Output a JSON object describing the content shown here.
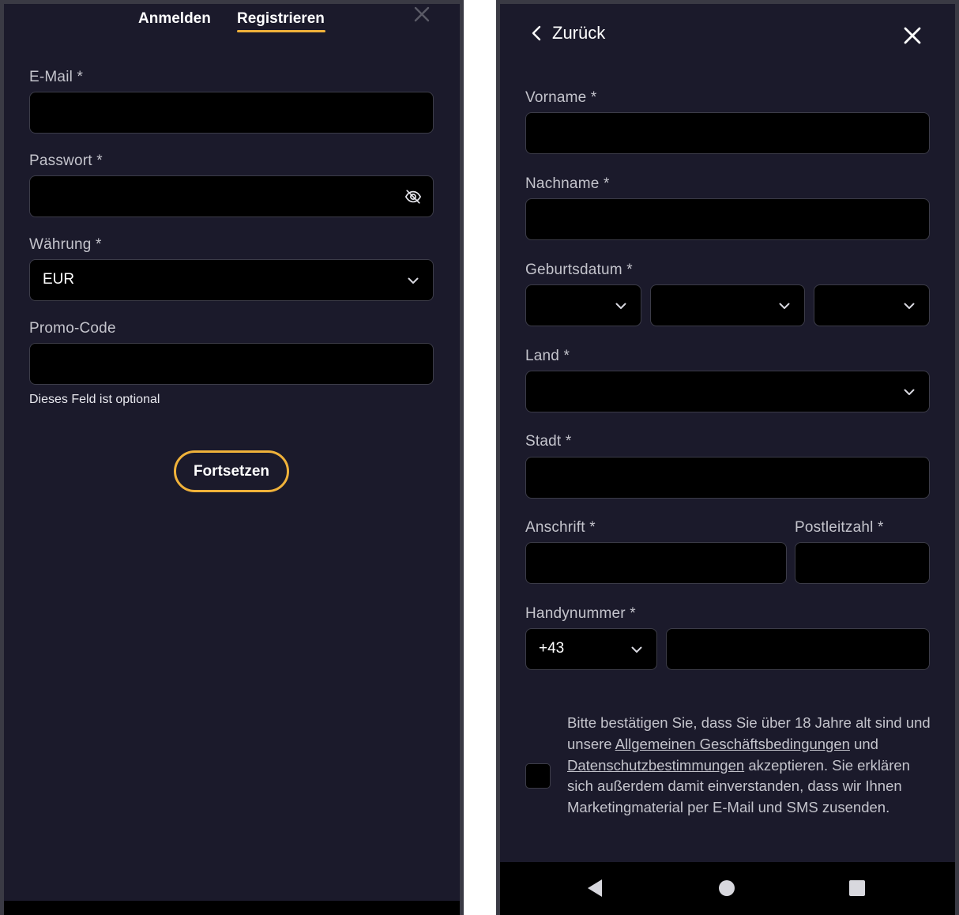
{
  "registration": {
    "tabs": [
      "Anmelden",
      "Registrieren"
    ],
    "active_tab": "Registrieren",
    "email_label": "E-Mail *",
    "password_label": "Passwort *",
    "currency_label": "Währung *",
    "currency_value": "EUR",
    "promo_label": "Promo-Code",
    "promo_hint": "Dieses Feld ist optional",
    "continue_label": "Fortsetzen"
  },
  "personal": {
    "back_label": "Zurück",
    "first_name_label": "Vorname *",
    "last_name_label": "Nachname *",
    "birthdate_label": "Geburtsdatum *",
    "country_label": "Land *",
    "city_label": "Stadt *",
    "address_label": "Anschrift *",
    "postal_label": "Postleitzahl *",
    "phone_label": "Handynummer *",
    "phone_prefix": "+43",
    "terms": {
      "part1": "Bitte bestätigen Sie, dass Sie über 18 Jahre alt sind und unsere ",
      "link1": "Allgemeinen Geschäftsbedingungen",
      "part2": " und ",
      "link2": "Datenschutzbestimmungen",
      "part3": " akzeptieren. Sie erklären sich außerdem damit einverstanden, dass wir Ihnen Marketingmaterial per E-Mail und SMS zusenden."
    }
  },
  "colors": {
    "background": "#1b1a2b",
    "input_background": "#000000",
    "accent": "#f0b23a",
    "label": "#c4c4cc"
  },
  "icons": [
    "close-icon",
    "eye-off-icon",
    "chevron-down-icon",
    "chevron-left-icon",
    "nav-back-icon",
    "nav-home-icon",
    "nav-recents-icon"
  ]
}
